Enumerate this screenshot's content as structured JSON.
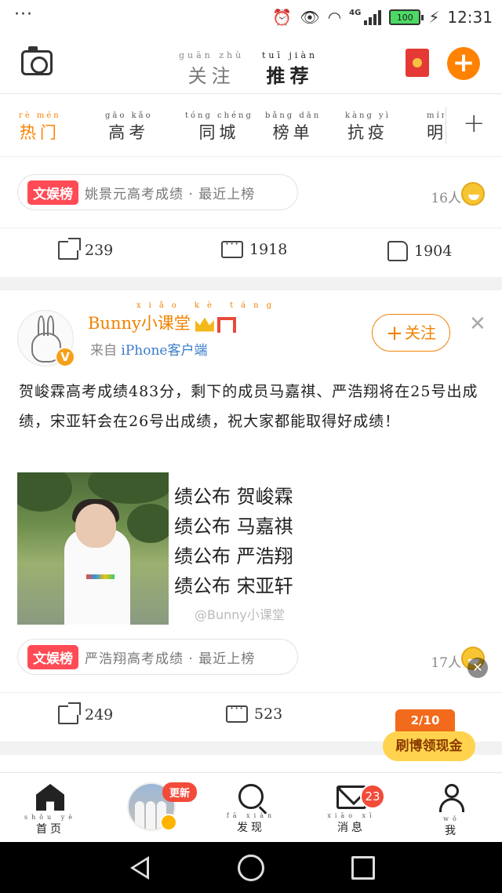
{
  "status_bar": {
    "dots": "···",
    "network": "4G",
    "battery": "100",
    "time": "12:31"
  },
  "header": {
    "tabs": [
      {
        "pinyin": "guān zhù",
        "label": "关注",
        "active": false
      },
      {
        "pinyin": "tuī jiàn",
        "label": "推荐",
        "active": true
      }
    ],
    "plus": "+"
  },
  "channels": [
    {
      "pinyin": "rè mén",
      "label": "热门",
      "active": true
    },
    {
      "pinyin": "gāo kǎo",
      "label": "高考",
      "active": false
    },
    {
      "pinyin": "tóng chéng",
      "label": "同城",
      "active": false
    },
    {
      "pinyin": "bǎng dān",
      "label": "榜单",
      "active": false
    },
    {
      "pinyin": "kàng yì",
      "label": "抗疫",
      "active": false
    },
    {
      "pinyin": "míng",
      "label": "明",
      "active": false
    }
  ],
  "channel_add": "+",
  "feed": {
    "post1": {
      "topic_tag": "文娱榜",
      "topic_text": "姚景元高考成绩 · 最近上榜",
      "readers": "16人",
      "reposts": "239",
      "comments": "1918",
      "likes": "1904"
    },
    "post2": {
      "username": "Bunny小课堂",
      "username_pinyin": "xiǎo kè táng",
      "source": "来自 iPhone客户端",
      "source_prefix": "来自",
      "source_device": "iPhone客户端",
      "follow_label": "关注",
      "follow_plus": "+",
      "close": "✕",
      "text": "贺峻霖高考成绩483分，剩下的成员马嘉祺、严浩翔将在25号出成绩，宋亚轩会在26号出成绩，祝大家都能取得好成绩！",
      "image_lines": [
        "绩公布 贺峻霖",
        "绩公布 马嘉祺",
        "绩公布 严浩翔",
        "绩公布 宋亚轩"
      ],
      "watermark": "@Bunny小课堂",
      "topic_tag": "文娱榜",
      "topic_text": "严浩翔高考成绩 · 最近上榜",
      "readers": "17人",
      "reposts": "249",
      "comments": "523"
    }
  },
  "float_ad": {
    "counter": "2/10",
    "label": "刷博领现金",
    "close": "✕"
  },
  "bottom_nav": {
    "items": [
      {
        "pinyin": "shǒu yè",
        "label": "首页"
      },
      {
        "pinyin": "fā xiàn",
        "label": "发现"
      },
      {
        "pinyin": "xiāo xī",
        "label": "消息"
      },
      {
        "pinyin": "wǒ",
        "label": "我"
      }
    ],
    "update_badge": "更新",
    "message_count": "23"
  },
  "colors": {
    "accent": "#ff8200",
    "badge_red": "#f24b3a",
    "topic_tag": "#ff4b55",
    "link_blue": "#3a7bc8"
  }
}
